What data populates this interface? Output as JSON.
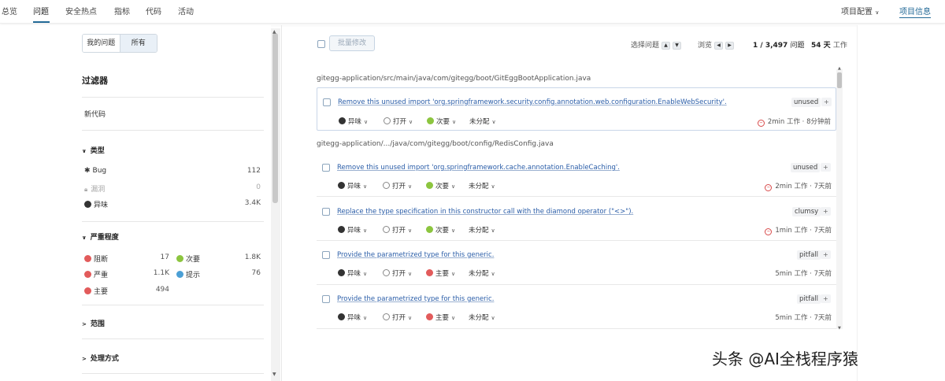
{
  "nav": {
    "items": [
      "总览",
      "问题",
      "安全热点",
      "指标",
      "代码",
      "活动"
    ],
    "project_config": "项目配置",
    "project_info": "项目信息"
  },
  "sidebar": {
    "toggle": {
      "mine": "我的问题",
      "all": "所有"
    },
    "filters_title": "过滤器",
    "new_code": "新代码",
    "type": {
      "title": "类型",
      "items": [
        {
          "label": "Bug",
          "count": "112",
          "icon": "bug-icon"
        },
        {
          "label": "漏洞",
          "count": "0",
          "icon": "lock-icon"
        },
        {
          "label": "异味",
          "count": "3.4K",
          "icon": "code-smell-icon"
        }
      ]
    },
    "severity": {
      "title": "严重程度",
      "items": [
        {
          "label": "阻断",
          "count": "17",
          "icon": "blocker-icon"
        },
        {
          "label": "次要",
          "count": "1.8K",
          "icon": "minor-icon"
        },
        {
          "label": "严重",
          "count": "1.1K",
          "icon": "critical-icon"
        },
        {
          "label": "提示",
          "count": "76",
          "icon": "info-icon"
        },
        {
          "label": "主要",
          "count": "494",
          "icon": "major-icon"
        }
      ]
    },
    "scope": "范围",
    "resolution": "处理方式"
  },
  "toolbar": {
    "bulk_change": "批量修改",
    "select_issue": "选择问题",
    "browse": "浏览",
    "count": "1 / 3,497",
    "count_unit": "问题",
    "effort_value": "54 天",
    "effort_unit": "工作"
  },
  "issues": {
    "file1": "gitegg-application/src/main/java/com/gitegg/boot/GitEggBootApplication.java",
    "file2": "gitegg-application/.../java/com/gitegg/boot/config/RedisConfig.java",
    "list": [
      {
        "message": "Remove this unused import 'org.springframework.security.config.annotation.web.configuration.EnableWebSecurity'.",
        "tag": "unused",
        "type": "异味",
        "status": "打开",
        "severity": "次要",
        "assignee": "未分配",
        "effort": "2min 工作",
        "age": "8分钟前"
      },
      {
        "message": "Remove this unused import 'org.springframework.cache.annotation.EnableCaching'.",
        "tag": "unused",
        "type": "异味",
        "status": "打开",
        "severity": "次要",
        "assignee": "未分配",
        "effort": "2min 工作",
        "age": "7天前"
      },
      {
        "message": "Replace the type specification in this constructor call with the diamond operator (\"<>\").",
        "tag": "clumsy",
        "type": "异味",
        "status": "打开",
        "severity": "次要",
        "assignee": "未分配",
        "effort": "1min 工作",
        "age": "7天前"
      },
      {
        "message": "Provide the parametrized type for this generic.",
        "tag": "pitfall",
        "type": "异味",
        "status": "打开",
        "severity": "主要",
        "assignee": "未分配",
        "effort": "5min 工作",
        "age": "7天前"
      },
      {
        "message": "Provide the parametrized type for this generic.",
        "tag": "pitfall",
        "type": "异味",
        "status": "打开",
        "severity": "主要",
        "assignee": "未分配",
        "effort": "5min 工作",
        "age": "7天前"
      }
    ]
  },
  "watermark": "头条 @AI全栈程序猿",
  "colors": {
    "accent": "#236a97",
    "link": "#2a5da8",
    "major": "#e25b5b",
    "minor": "#8cc53f",
    "info": "#4b9fd5"
  }
}
